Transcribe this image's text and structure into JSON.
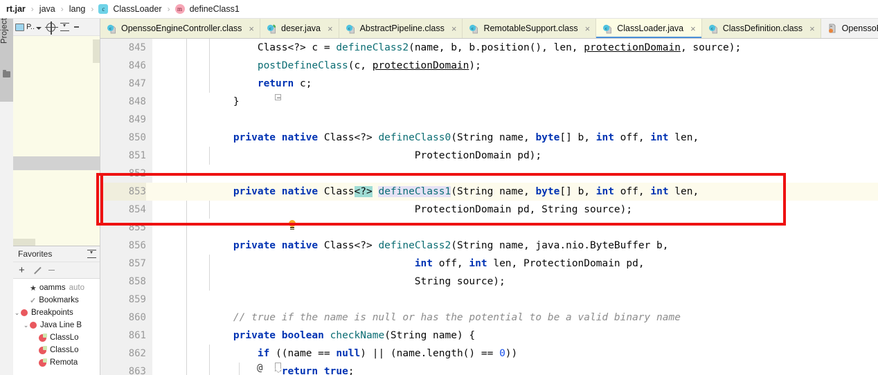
{
  "breadcrumb": {
    "items": [
      {
        "label": "rt.jar",
        "bold": true,
        "badge": null
      },
      {
        "label": "java",
        "bold": false,
        "badge": null
      },
      {
        "label": "lang",
        "bold": false,
        "badge": null
      },
      {
        "label": "ClassLoader",
        "bold": false,
        "badge": "c"
      },
      {
        "label": "defineClass1",
        "bold": false,
        "badge": "m"
      }
    ],
    "separator": "›"
  },
  "tabs": [
    {
      "label": "OpenssoEngineController.class",
      "icon": "class-file-icon",
      "active": false,
      "closable": true
    },
    {
      "label": "deser.java",
      "icon": "java-file-icon",
      "active": false,
      "closable": true
    },
    {
      "label": "AbstractPipeline.class",
      "icon": "class-file-icon",
      "active": false,
      "closable": true
    },
    {
      "label": "RemotableSupport.class",
      "icon": "class-file-icon",
      "active": false,
      "closable": true
    },
    {
      "label": "ClassLoader.java",
      "icon": "class-file-icon",
      "active": true,
      "closable": true
    },
    {
      "label": "ClassDefinition.class",
      "icon": "class-file-icon",
      "active": false,
      "closable": true
    },
    {
      "label": "OpenssoEngin",
      "icon": "jar-file-icon",
      "active": false,
      "closable": false
    }
  ],
  "tab_close_glyph": "×",
  "tool_strip": {
    "label": "Project"
  },
  "project_panel": {
    "toolbar": {
      "view_label": "P..",
      "icons": [
        "project-view-icon",
        "locate-icon",
        "collapse-all-icon",
        "more-icon"
      ]
    }
  },
  "favorites": {
    "title": "Favorites",
    "toolbar": {
      "add": "+",
      "edit": "edit-icon",
      "remove": "−"
    },
    "tree": [
      {
        "indent": 1,
        "arrow": "",
        "icon": "star-icon",
        "label": "oamms",
        "suffix": "auto"
      },
      {
        "indent": 1,
        "arrow": "",
        "icon": "bookmark-check-icon",
        "label": "Bookmarks",
        "suffix": ""
      },
      {
        "indent": 0,
        "arrow": "⌄",
        "icon": "breakpoint-icon",
        "label": "Breakpoints",
        "suffix": ""
      },
      {
        "indent": 1,
        "arrow": "⌄",
        "icon": "breakpoint-icon",
        "label": "Java Line B",
        "suffix": ""
      },
      {
        "indent": 2,
        "arrow": "",
        "icon": "breakpoint-verified-icon",
        "label": "ClassLo",
        "suffix": ""
      },
      {
        "indent": 2,
        "arrow": "",
        "icon": "breakpoint-verified-icon",
        "label": "ClassLo",
        "suffix": ""
      },
      {
        "indent": 2,
        "arrow": "",
        "icon": "breakpoint-verified-icon",
        "label": "Remota",
        "suffix": ""
      }
    ]
  },
  "editor": {
    "file": "ClassLoader.java",
    "first_line": 845,
    "highlighted_line": 853,
    "red_box_lines": [
      853,
      855
    ],
    "gutter_bulb_line": 853,
    "annotation_marker": "@",
    "annotation_marker_line": 861,
    "lines": [
      {
        "n": "845",
        "tokens": [
          {
            "t": "        Class<?> c = ",
            "c": ""
          },
          {
            "t": "defineClass2",
            "c": "mth"
          },
          {
            "t": "(name, b, b.position(), len, ",
            "c": ""
          },
          {
            "t": "protectionDomain",
            "c": "fld"
          },
          {
            "t": ", source);",
            "c": ""
          }
        ]
      },
      {
        "n": "846",
        "tokens": [
          {
            "t": "        ",
            "c": ""
          },
          {
            "t": "postDefineClass",
            "c": "mth"
          },
          {
            "t": "(c, ",
            "c": ""
          },
          {
            "t": "protectionDomain",
            "c": "fld"
          },
          {
            "t": ");",
            "c": ""
          }
        ]
      },
      {
        "n": "847",
        "tokens": [
          {
            "t": "        ",
            "c": ""
          },
          {
            "t": "return",
            "c": "kw"
          },
          {
            "t": " c;",
            "c": ""
          }
        ]
      },
      {
        "n": "848",
        "tokens": [
          {
            "t": "    }",
            "c": ""
          }
        ]
      },
      {
        "n": "849",
        "tokens": []
      },
      {
        "n": "850",
        "tokens": [
          {
            "t": "    ",
            "c": ""
          },
          {
            "t": "private native",
            "c": "kw"
          },
          {
            "t": " Class<?> ",
            "c": ""
          },
          {
            "t": "defineClass0",
            "c": "mth"
          },
          {
            "t": "(String name, ",
            "c": ""
          },
          {
            "t": "byte",
            "c": "kw"
          },
          {
            "t": "[] b, ",
            "c": ""
          },
          {
            "t": "int",
            "c": "kw"
          },
          {
            "t": " off, ",
            "c": ""
          },
          {
            "t": "int",
            "c": "kw"
          },
          {
            "t": " len,",
            "c": ""
          }
        ]
      },
      {
        "n": "851",
        "tokens": [
          {
            "t": "                                  ProtectionDomain pd);",
            "c": ""
          }
        ]
      },
      {
        "n": "852",
        "tokens": []
      },
      {
        "n": "853",
        "tokens": [
          {
            "t": "    ",
            "c": ""
          },
          {
            "t": "private native",
            "c": "kw"
          },
          {
            "t": " Class",
            "c": ""
          },
          {
            "t": "<?>",
            "c": "sel"
          },
          {
            "t": " ",
            "c": ""
          },
          {
            "t": "defineClass1",
            "c": "mth occ"
          },
          {
            "t": "(String name, ",
            "c": ""
          },
          {
            "t": "byte",
            "c": "kw"
          },
          {
            "t": "[] b, ",
            "c": ""
          },
          {
            "t": "int",
            "c": "kw"
          },
          {
            "t": " off, ",
            "c": ""
          },
          {
            "t": "int",
            "c": "kw"
          },
          {
            "t": " len,",
            "c": ""
          }
        ]
      },
      {
        "n": "854",
        "tokens": [
          {
            "t": "                                  ProtectionDomain pd, String source);",
            "c": ""
          }
        ]
      },
      {
        "n": "855",
        "tokens": []
      },
      {
        "n": "856",
        "tokens": [
          {
            "t": "    ",
            "c": ""
          },
          {
            "t": "private native",
            "c": "kw"
          },
          {
            "t": " Class<?> ",
            "c": ""
          },
          {
            "t": "defineClass2",
            "c": "mth"
          },
          {
            "t": "(String name, java.nio.ByteBuffer b,",
            "c": ""
          }
        ]
      },
      {
        "n": "857",
        "tokens": [
          {
            "t": "                                  ",
            "c": ""
          },
          {
            "t": "int",
            "c": "kw"
          },
          {
            "t": " off, ",
            "c": ""
          },
          {
            "t": "int",
            "c": "kw"
          },
          {
            "t": " len, ProtectionDomain pd,",
            "c": ""
          }
        ]
      },
      {
        "n": "858",
        "tokens": [
          {
            "t": "                                  String source);",
            "c": ""
          }
        ]
      },
      {
        "n": "859",
        "tokens": []
      },
      {
        "n": "860",
        "tokens": [
          {
            "t": "    // true if the name is null or has the potential to be a valid binary name",
            "c": "cmt"
          }
        ]
      },
      {
        "n": "861",
        "tokens": [
          {
            "t": "    ",
            "c": ""
          },
          {
            "t": "private boolean",
            "c": "kw"
          },
          {
            "t": " ",
            "c": ""
          },
          {
            "t": "checkName",
            "c": "mth"
          },
          {
            "t": "(String name) {",
            "c": ""
          }
        ]
      },
      {
        "n": "862",
        "tokens": [
          {
            "t": "        ",
            "c": ""
          },
          {
            "t": "if",
            "c": "kw"
          },
          {
            "t": " ((name == ",
            "c": ""
          },
          {
            "t": "null",
            "c": "kw"
          },
          {
            "t": ") || (name.length() == ",
            "c": ""
          },
          {
            "t": "0",
            "c": "num"
          },
          {
            "t": "))",
            "c": ""
          }
        ]
      },
      {
        "n": "863",
        "tokens": [
          {
            "t": "            ",
            "c": ""
          },
          {
            "t": "return true",
            "c": "kw"
          },
          {
            "t": ";",
            "c": ""
          }
        ]
      }
    ]
  },
  "colors": {
    "accent_blue": "#4a90d9",
    "highlight_red": "#ee1111",
    "keyword": "#0033b3",
    "type_method": "#0b6d73",
    "number": "#1750eb",
    "comment": "#8c8c8c",
    "selection_teal": "#9fdcd4",
    "occurrence_lilac": "#e6e2f5",
    "tab_inactive": "#eff0d9",
    "tab_active": "#fcfce4",
    "line_highlight": "#fdfbec",
    "breakpoint_red": "#e9585e",
    "bulb_orange": "#f5a623"
  }
}
